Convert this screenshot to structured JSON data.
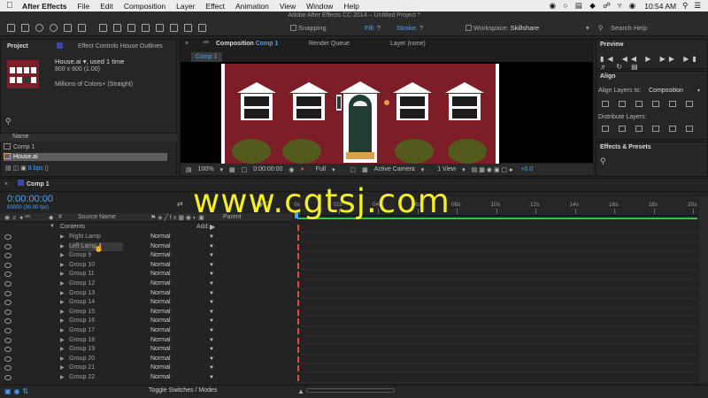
{
  "menubar": {
    "app_name": "After Effects",
    "items": [
      "File",
      "Edit",
      "Composition",
      "Layer",
      "Effect",
      "Animation",
      "View",
      "Window",
      "Help"
    ],
    "time": "10:54 AM",
    "search": "Search Help"
  },
  "window_title": "Adobe After Effects CC 2014 – Untitled Project *",
  "toolbar": {
    "snapping": "Snapping",
    "fill_label": "Fill:",
    "fill_value": "?",
    "stroke_label": "Stroke:",
    "stroke_value": "?",
    "workspace_label": "Workspace:",
    "workspace_value": "Skillshare"
  },
  "project": {
    "tab_label": "Project",
    "effect_controls_tab": "Effect Controls House Outlines",
    "selected_file": "House.ai",
    "used_text": ", used 1 time",
    "dimensions": "800 x 600 (1.00)",
    "color_info": "Millions of Colors+ (Straight)",
    "column_name": "Name",
    "items": [
      "Comp 1",
      "House.ai"
    ],
    "bpc": "8 bpc"
  },
  "viewer": {
    "comp_tab_prefix": "Composition",
    "comp_tab_name": "Comp 1",
    "render_queue_tab": "Render Queue",
    "layer_tab": "Layer (none)",
    "comp_crumb": "Comp 1",
    "zoom": "100%",
    "timecode": "0:00:00:00",
    "resolution": "Full",
    "camera": "Active Camera",
    "view": "1 View",
    "exposure": "+0.0"
  },
  "preview": {
    "title": "Preview"
  },
  "align": {
    "title": "Align",
    "align_to_label": "Align Layers to:",
    "align_to_value": "Composition",
    "distribute_label": "Distribute Layers:"
  },
  "effects_presets": {
    "title": "Effects & Presets"
  },
  "timeline": {
    "tab": "Comp 1",
    "timecode": "0:00:00:00",
    "frame_info": "00000 (30.00 fps)",
    "col_source": "Source Name",
    "col_parent": "Parent",
    "contents_label": "Contents",
    "add_label": "Add:",
    "ruler_labels": [
      "0s",
      "02s",
      "04s",
      "06s",
      "08s",
      "10s",
      "12s",
      "14s",
      "16s",
      "18s",
      "20s"
    ],
    "toggle_label": "Toggle Switches / Modes",
    "layers": [
      {
        "name": "Right Lamp",
        "mode": "Normal"
      },
      {
        "name": "Left Lamp",
        "mode": "Normal"
      },
      {
        "name": "Group 9",
        "mode": "Normal"
      },
      {
        "name": "Group 10",
        "mode": "Normal"
      },
      {
        "name": "Group 11",
        "mode": "Normal"
      },
      {
        "name": "Group 12",
        "mode": "Normal"
      },
      {
        "name": "Group 13",
        "mode": "Normal"
      },
      {
        "name": "Group 14",
        "mode": "Normal"
      },
      {
        "name": "Group 15",
        "mode": "Normal"
      },
      {
        "name": "Group 16",
        "mode": "Normal"
      },
      {
        "name": "Group 17",
        "mode": "Normal"
      },
      {
        "name": "Group 18",
        "mode": "Normal"
      },
      {
        "name": "Group 19",
        "mode": "Normal"
      },
      {
        "name": "Group 20",
        "mode": "Normal"
      },
      {
        "name": "Group 21",
        "mode": "Normal"
      },
      {
        "name": "Group 22",
        "mode": "Normal"
      }
    ]
  },
  "watermark": "www.cgtsj.com",
  "colors": {
    "brick": "#7d1d28",
    "door": "#1f3d32",
    "accent_blue": "#4aa3ff",
    "playhead_red": "#e14a4a",
    "work_area_green": "#39c24a",
    "watermark_yellow": "#f4ee24"
  }
}
